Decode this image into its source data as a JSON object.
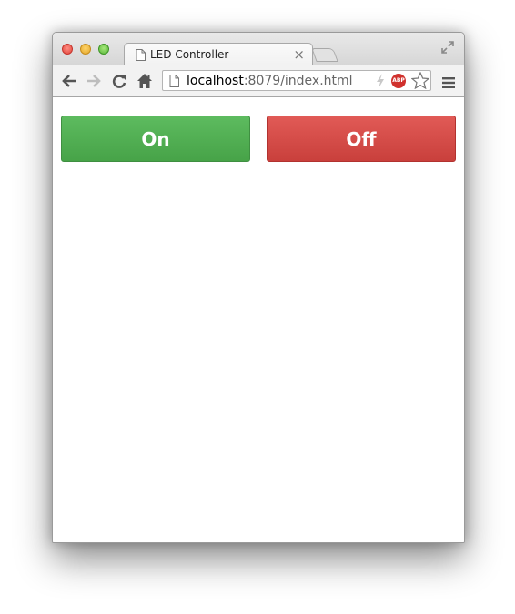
{
  "browser": {
    "tab_title": "LED Controller",
    "tab_close_glyph": "×",
    "url_host": "localhost",
    "url_path": ":8079/index.html",
    "extension_badge": "ABP",
    "icons": [
      "back-icon",
      "forward-icon",
      "reload-icon",
      "home-icon",
      "page-icon",
      "bolt-icon",
      "abp-icon",
      "star-icon",
      "menu-icon",
      "fullscreen-icon"
    ]
  },
  "page": {
    "on_label": "On",
    "off_label": "Off",
    "on_color": "#4caf50",
    "off_color": "#d9534f"
  }
}
